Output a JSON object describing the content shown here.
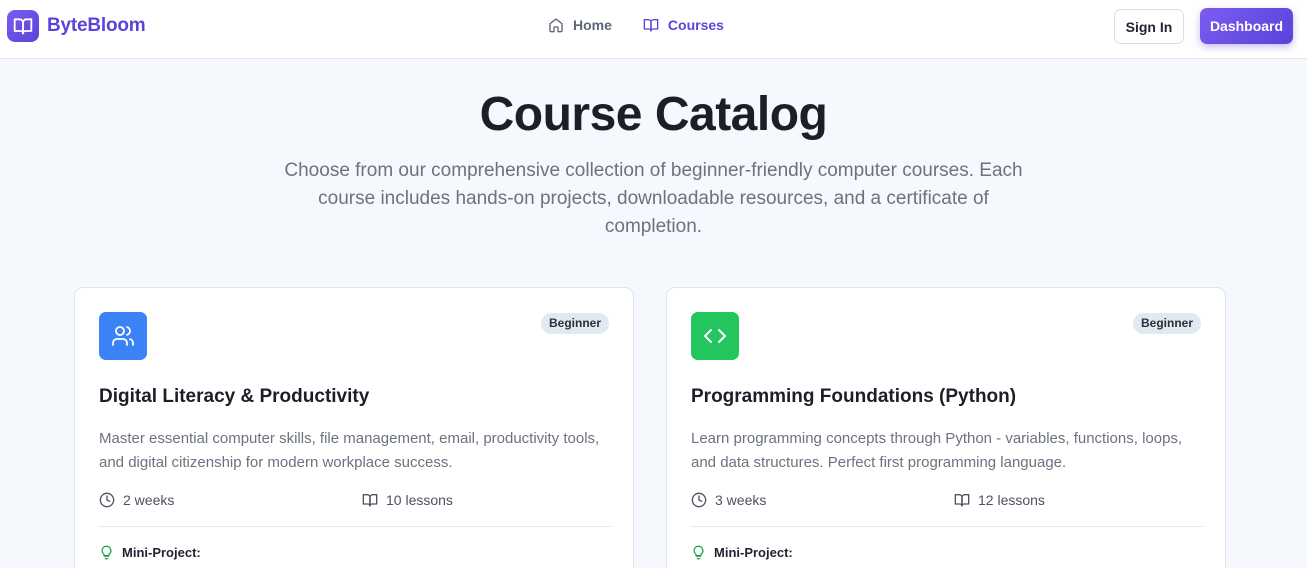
{
  "brand": {
    "name": "ByteBloom",
    "icon": "book-open-icon"
  },
  "nav": {
    "items": [
      {
        "label": "Home",
        "icon": "home-icon",
        "active": false
      },
      {
        "label": "Courses",
        "icon": "book-open-icon",
        "active": true
      }
    ],
    "sign_in_label": "Sign In",
    "dashboard_label": "Dashboard"
  },
  "hero": {
    "title": "Course Catalog",
    "subtitle": "Choose from our comprehensive collection of beginner-friendly computer courses. Each course includes hands-on projects, downloadable resources, and a certificate of completion."
  },
  "courses": [
    {
      "icon": "users-icon",
      "icon_color": "#3b82f6",
      "badge": "Beginner",
      "title": "Digital Literacy & Productivity",
      "description": "Master essential computer skills, file management, email, productivity tools, and digital citizenship for modern workplace success.",
      "duration": "2 weeks",
      "lessons": "10 lessons",
      "project_label": "Mini-Project:"
    },
    {
      "icon": "code-icon",
      "icon_color": "#22c55e",
      "badge": "Beginner",
      "title": "Programming Foundations (Python)",
      "description": "Learn programming concepts through Python - variables, functions, loops, and data structures. Perfect first programming language.",
      "duration": "3 weeks",
      "lessons": "12 lessons",
      "project_label": "Mini-Project:"
    }
  ],
  "colors": {
    "accent": "#5b45d8",
    "page_background": "#f5f9fd",
    "badge_background": "#e1e9f3",
    "project_icon": "#16a34a"
  }
}
